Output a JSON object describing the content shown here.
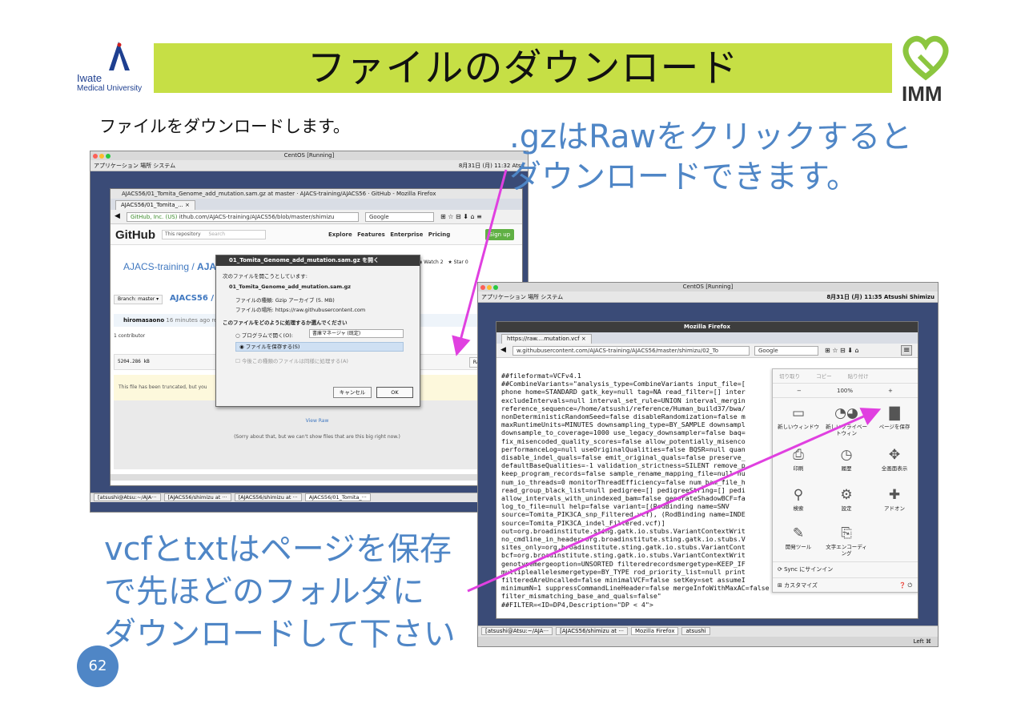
{
  "slide": {
    "title": "ファイルのダウンロード",
    "subtitle": "ファイルをダウンロードします。",
    "callout_top": [
      ".gzはRawをクリックすると",
      "ダウンロードできます。"
    ],
    "callout_bottom": [
      "vcfとtxtはページを保存",
      "で先ほどのフォルダに",
      "ダウンロードして下さい"
    ],
    "page_number": "62",
    "accent_color": "#4f86c6",
    "band_color": "#c6df45",
    "arrow_color": "#e040e0",
    "logo_left": {
      "line1": "Iwate",
      "line2": "Medical University",
      "icon": "iwate-medical-logo-icon"
    },
    "logo_right": {
      "text": "IMM",
      "icon": "imm-heart-logo-icon"
    }
  },
  "shot1": {
    "vm_title": "CentOS [Running]",
    "panel_left": "アプリケーション  場所  システム",
    "panel_right": "8月31日 (月) 11:32  Atsu",
    "window_title": "AJACS56/01_Tomita_Genome_add_mutation.sam.gz at master · AJACS-training/AJACS56 · GitHub - Mozilla Firefox",
    "tab": "AJACS56/01_Tomita_...",
    "url_site": "GitHub, Inc. (US)",
    "url": "ithub.com/AJACS-training/AJACS56/blob/master/shimizu",
    "search": "Google",
    "github": {
      "logo": "GitHub",
      "repo_search": "This repository",
      "repo_search_placeholder": "Search",
      "nav": "Explore  Features  Enterprise  Pricing",
      "signup": "Sign up",
      "repo_owner": "AJACS-training",
      "repo_sep": " / ",
      "repo_name": "AJACS",
      "watch": "Watch",
      "watch_count": "2",
      "star": "Star",
      "star_count": "0",
      "branch": "Branch: master ▾",
      "path": "AJACS56 / sl",
      "commit_user": "hiromasaono",
      "commit_time": "16 minutes ago re",
      "contributors": "1 contributor",
      "file_size": "5204.286 kB",
      "raw": "Raw",
      "truncated": "This file has been truncated, but you",
      "view_raw": "View Raw",
      "sorry": "(Sorry about that, but we can't show files that are this big right now.)"
    },
    "dialog": {
      "title": "01_Tomita_Genome_add_mutation.sam.gz を開く",
      "opening": "次のファイルを開こうとしています:",
      "filename": "01_Tomita_Genome_add_mutation.sam.gz",
      "type": "ファイルの種類: Gzip アーカイブ (5. MB)",
      "from": "ファイルの場所: https://raw.githubusercontent.com",
      "question": "このファイルをどのように処理するか選んでください",
      "open_with": "プログラムで開く(O):",
      "open_with_app": "書庫マネージャ (既定)",
      "save_file": "ファイルを保存する(S)",
      "remember": "今後この種類のファイルは同様に処理する(A)",
      "cancel": "キャンセル",
      "ok": "OK"
    },
    "taskbar": [
      "[atsushi@Atsu:~/AJA···",
      "[AJACS56/shimizu at ···",
      "[AJACS56/shimizu at ···",
      "AJACS56/01_Tomita_···"
    ]
  },
  "shot2": {
    "vm_title": "CentOS [Running]",
    "panel_left": "アプリケーション  場所  システム",
    "panel_right": "8月31日 (月) 11:35  Atsushi Shimizu",
    "window_title": "Mozilla Firefox",
    "tab": "https://raw....mutation.vcf",
    "url": "w.githubusercontent.com/AJACS-training/AJACS56/master/shimizu/02_To",
    "search": "Google",
    "vcf_lines": [
      "##fileformat=VCFv4.1",
      "##CombineVariants=\"analysis_type=CombineVariants input_file=[",
      "phone home=STANDARD gatk_key=null tag=NA read_filter=[] inter",
      "excludeIntervals=null interval_set_rule=UNION interval_mergin",
      "reference_sequence=/home/atsushi/reference/Human_build37/bwa/",
      "nonDeterministicRandomSeed=false disableRandomization=false m",
      "maxRuntimeUnits=MINUTES downsampling_type=BY_SAMPLE downsampl",
      "downsample_to_coverage=1000 use_legacy_downsampler=false baq=",
      "fix_misencoded_quality_scores=false allow_potentially_misenco",
      "performanceLog=null useOriginalQualities=false BQSR=null quan",
      "disable_indel_quals=false emit_original_quals=false preserve_",
      "defaultBaseQualities=-1 validation_strictness=SILENT remove_p",
      "keep_program_records=false sample_rename_mapping_file=null nu",
      "num_io_threads=0 monitorThreadEfficiency=false num_bam_file_h",
      "read_group_black_list=null pedigree=[] pedigreeString=[] pedi",
      "allow_intervals_with_unindexed_bam=false generateShadowBCF=fa",
      "log_to_file=null help=false variant=[(RodBinding name=SNV",
      "source=Tomita_PIK3CA_snp_Filtered.vcf), (RodBinding name=INDE",
      "source=Tomita_PIK3CA_indel_Filtered.vcf)]",
      "out=org.broadinstitute.sting.gatk.io.stubs.VariantContextWrit",
      "no_cmdline_in_header=org.broadinstitute.sting.gatk.io.stubs.V",
      "sites_only=org.broadinstitute.sting.gatk.io.stubs.VariantCont",
      "bcf=org.broadinstitute.sting.gatk.io.stubs.VariantContextWrit",
      "genotypemergeoption=UNSORTED filteredrecordsmergetype=KEEP_IF",
      "multipleallelesmergetype=BY_TYPE rod_priority_list=null print",
      "filteredAreUncalled=false minimalVCF=false setKey=set assumeI",
      "minimumN=1 suppressCommandLineHeader=false mergeInfoWithMaxAC=false",
      "filter_mismatching_base_and_quals=false\"",
      "##FILTER=<ID=DP4,Description=\"DP < 4\">"
    ],
    "menu": {
      "cut": "切り取り",
      "copy": "コピー",
      "paste": "貼り付け",
      "zoom_minus": "−",
      "zoom": "100%",
      "zoom_plus": "+",
      "tiles": [
        {
          "label": "新しいウィンドウ",
          "icon": "new-window-icon"
        },
        {
          "label": "新しいプライベートウィン",
          "icon": "private-window-icon"
        },
        {
          "label": "ページを保存",
          "icon": "save-page-icon"
        },
        {
          "label": "印刷",
          "icon": "print-icon"
        },
        {
          "label": "履歴",
          "icon": "history-icon"
        },
        {
          "label": "全画面表示",
          "icon": "fullscreen-icon"
        },
        {
          "label": "検索",
          "icon": "search-icon"
        },
        {
          "label": "設定",
          "icon": "settings-icon"
        },
        {
          "label": "アドオン",
          "icon": "addons-icon"
        },
        {
          "label": "開発ツール",
          "icon": "developer-icon"
        },
        {
          "label": "文字エンコーディング",
          "icon": "encoding-icon"
        }
      ],
      "sync": "Sync にサインイン",
      "customize": "カスタマイズ"
    },
    "taskbar": [
      "[atsushi@Atsu:~/AJA···",
      "[AJACS56/shimizu at ···",
      "Mozilla Firefox",
      "atsushi"
    ],
    "tray_right": "Left ⌘"
  }
}
